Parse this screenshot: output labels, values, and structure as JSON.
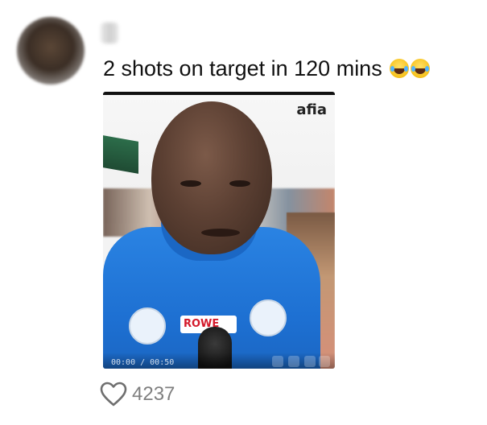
{
  "comment": {
    "text": "2 shots on target in 120 mins",
    "emojis": [
      "😂",
      "😂"
    ]
  },
  "video": {
    "watermark": "afia",
    "time_label": "00:00 / 00:50",
    "shirt_logo": "ROWE"
  },
  "likes": {
    "count": "4237",
    "icon": "heart-outline-icon"
  }
}
